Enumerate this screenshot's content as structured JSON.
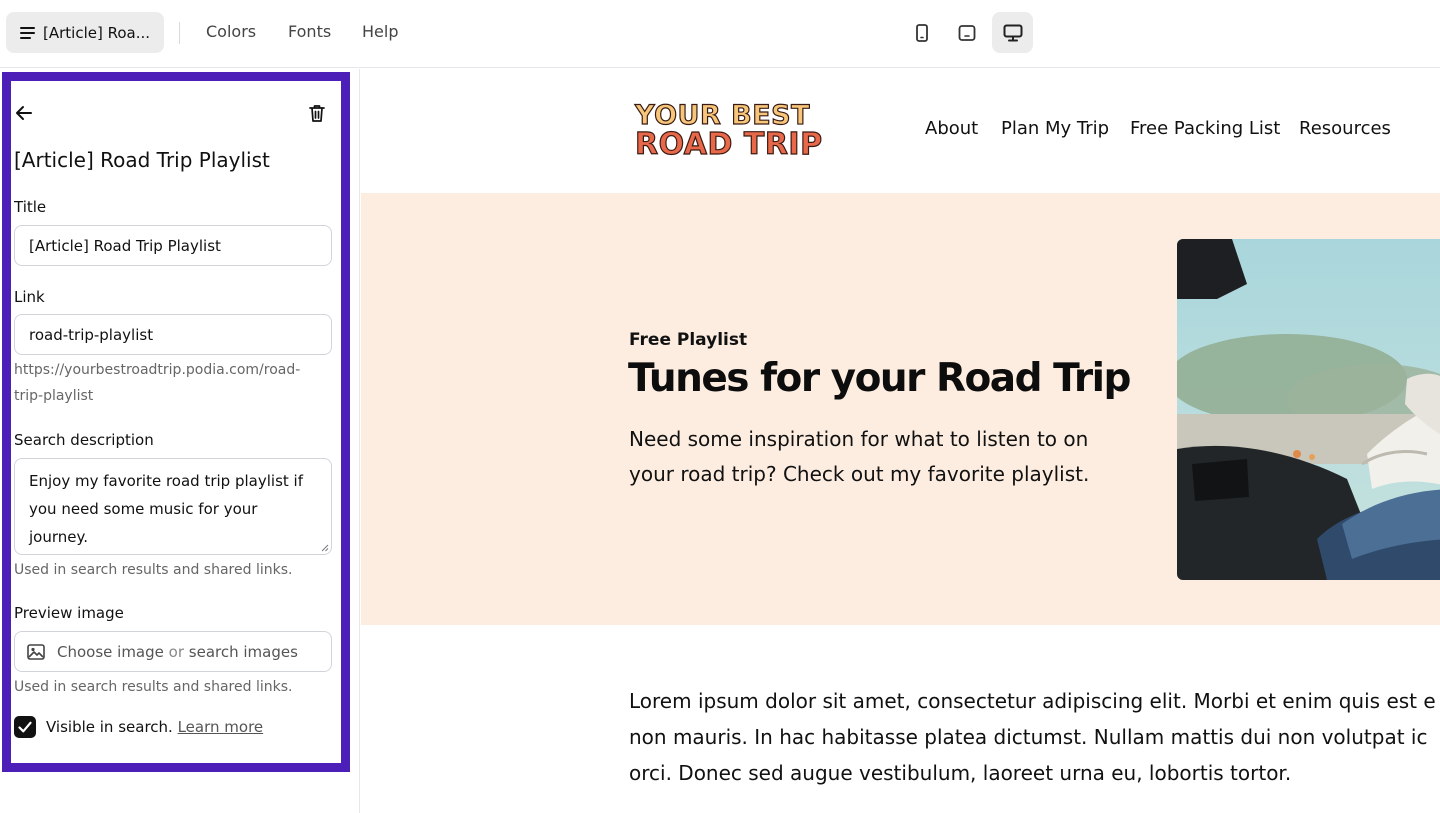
{
  "topbar": {
    "page_pill_label": "[Article] Roa...",
    "menu": [
      "Colors",
      "Fonts",
      "Help"
    ],
    "devices": [
      {
        "icon": "mobile-icon",
        "active": false
      },
      {
        "icon": "tablet-icon",
        "active": false
      },
      {
        "icon": "desktop-icon",
        "active": true
      }
    ]
  },
  "panel": {
    "heading": "[Article] Road Trip Playlist",
    "title_label": "Title",
    "title_value": "[Article] Road Trip Playlist",
    "link_label": "Link",
    "link_value": "road-trip-playlist",
    "link_url_line1": "https://yourbestroadtrip.podia.com/road-",
    "link_url_line2": "trip-playlist",
    "search_desc_label": "Search description",
    "search_desc_value": "Enjoy my favorite road trip playlist if you need some music for your journey.",
    "search_desc_hint": "Used in search results and shared links.",
    "preview_image_label": "Preview image",
    "choose_image": "Choose image",
    "or": "or",
    "search_images": "search images",
    "preview_image_hint": "Used in search results and shared links.",
    "visible_label": "Visible in search.",
    "learn_more": "Learn more",
    "visible_checked": true
  },
  "site": {
    "logo_line1": "YOUR BEST",
    "logo_line2": "ROAD TRIP",
    "nav": [
      "About",
      "Plan My Trip",
      "Free Packing List",
      "Resources"
    ],
    "hero_eyebrow": "Free Playlist",
    "hero_title": "Tunes for your Road Trip",
    "hero_sub": "Need some inspiration for what to listen to on your road trip? Check out my favorite playlist.",
    "body_lines": [
      "Lorem ipsum dolor sit amet, consectetur adipiscing elit. Morbi et enim quis est e",
      "non mauris. In hac habitasse platea dictumst. Nullam mattis dui non volutpat ic",
      "orci. Donec sed augue vestibulum, laoreet urna eu, lobortis tortor."
    ]
  },
  "colors": {
    "panel_border": "#4b1fb8",
    "hero_bg": "#fcede0",
    "logo_yellow": "#f6c77b",
    "logo_red": "#e8684a"
  }
}
